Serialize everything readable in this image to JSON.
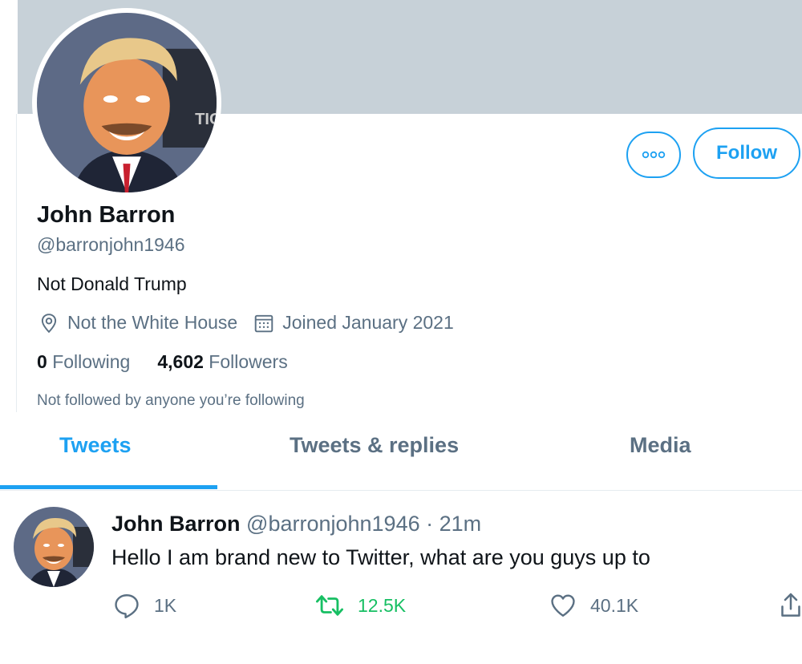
{
  "profile": {
    "name": "John Barron",
    "handle": "@barronjohn1946",
    "bio": "Not Donald Trump",
    "location": "Not the White House",
    "joined": "Joined January 2021",
    "following_count": "0",
    "following_label": "Following",
    "followers_count": "4,602",
    "followers_label": "Followers",
    "followed_by_note": "Not followed by anyone you’re following"
  },
  "actions": {
    "follow_label": "Follow",
    "more_icon": "more-icon"
  },
  "tabs": [
    {
      "label": "Tweets",
      "active": true
    },
    {
      "label": "Tweets & replies",
      "active": false
    },
    {
      "label": "Media",
      "active": false
    }
  ],
  "tweet": {
    "author_name": "John Barron",
    "author_handle": "@barronjohn1946",
    "separator": "·",
    "time": "21m",
    "text": "Hello I am brand new to Twitter, what are you guys up to",
    "replies": "1K",
    "retweets": "12.5K",
    "likes": "40.1K"
  },
  "colors": {
    "accent": "#1da1f2",
    "banner": "#c7d1d8",
    "retweet": "#17bf63",
    "secondary_text": "#5b7083"
  }
}
